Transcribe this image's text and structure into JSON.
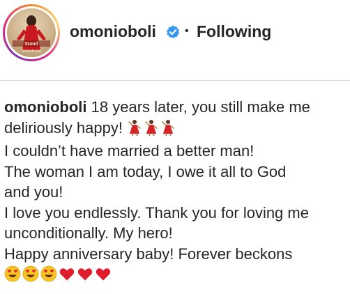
{
  "post": {
    "author": "omonioboli",
    "separator": "•",
    "follow_status": "Following",
    "avatar_text": [
      "Stand",
      "Sisterhood"
    ]
  },
  "caption": {
    "username": "omonioboli",
    "line1": " 18 years later, you still make me",
    "line2": "deliriously happy! ",
    "line3": "I couldn’t have married a better man!",
    "line4": "The woman I am today, I owe it all to God",
    "line5": "and you!",
    "line6": "I love you endlessly. Thank you for loving me",
    "line7": "unconditionally. My hero!",
    "line8": "Happy anniversary baby! Forever beckons",
    "dancer_emojis": [
      "woman-dancing-icon",
      "woman-dancing-icon",
      "woman-dancing-icon"
    ],
    "end_emojis": [
      "heart-eyes-face-icon",
      "heart-eyes-face-icon",
      "heart-eyes-face-icon",
      "red-heart-icon",
      "red-heart-icon",
      "red-heart-icon"
    ]
  },
  "colors": {
    "text": "#262626",
    "verified_blue": "#3897f0",
    "divider": "#dbdbdb"
  }
}
